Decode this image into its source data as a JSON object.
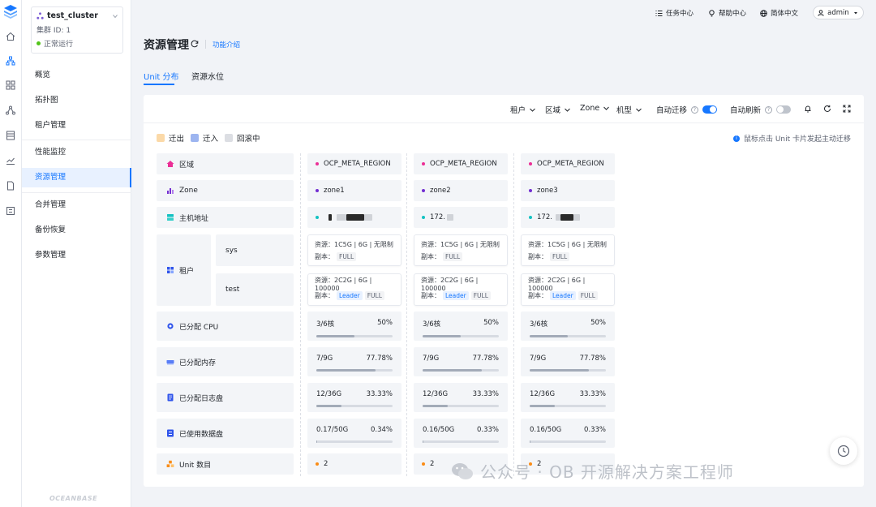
{
  "sidebar": {
    "cluster": {
      "name": "test_cluster",
      "id_text": "集群 ID: 1",
      "status": "正常运行"
    },
    "items": [
      {
        "label": "概览"
      },
      {
        "label": "拓扑图"
      },
      {
        "label": "租户管理"
      },
      {
        "label": "性能监控"
      },
      {
        "label": "资源管理"
      },
      {
        "label": "合并管理"
      },
      {
        "label": "备份恢复"
      },
      {
        "label": "参数管理"
      }
    ],
    "active_item": "资源管理",
    "footer_brand": "OCEANBASE"
  },
  "topbar": {
    "links": [
      {
        "label": "任务中心",
        "icon": "list-icon"
      },
      {
        "label": "帮助中心",
        "icon": "bulb-icon"
      },
      {
        "label": "简体中文",
        "icon": "globe-icon"
      }
    ],
    "user": "admin"
  },
  "header": {
    "title": "资源管理",
    "feature_link": "功能介绍"
  },
  "tabs": [
    {
      "label": "Unit 分布"
    },
    {
      "label": "资源水位"
    }
  ],
  "filters": {
    "region": "区域",
    "zone": "Zone",
    "machine": "机型",
    "tenant": "租户",
    "auto_migrate_label": "自动迁移",
    "auto_migrate_on": true,
    "auto_refresh_label": "自动刷新",
    "auto_refresh_on": false
  },
  "legend": [
    {
      "label": "迁出",
      "color": "#fbd9a8"
    },
    {
      "label": "迁入",
      "color": "#9db5f0"
    },
    {
      "label": "回滚中",
      "color": "#dcdee3"
    }
  ],
  "hint": "鼠标点击 Unit 卡片发起主动迁移",
  "rows": {
    "region": "区域",
    "zone": "Zone",
    "host": "主机地址",
    "tenant": "租户",
    "tenant_sys": "sys",
    "tenant_test": "test",
    "cpu": "已分配 CPU",
    "memory": "已分配内存",
    "log_disk": "已分配日志盘",
    "data_disk": "已使用数据盘",
    "unit_count": "Unit 数目"
  },
  "units": [
    {
      "region": "OCP_META_REGION",
      "zone": "zone1",
      "host": "",
      "sys": {
        "resource": "资源：1C5G | 6G | 无限制",
        "replica_label": "副本：",
        "replica": "FULL"
      },
      "test": {
        "resource": "资源：2C2G | 6G | 100000",
        "replica_label": "副本：",
        "leader": "Leader",
        "replica": "FULL"
      },
      "cpu": {
        "text": "3/6核",
        "pct": "50%",
        "value": 0.5
      },
      "memory": {
        "text": "7/9G",
        "pct": "77.78%",
        "value": 0.7778
      },
      "log_disk": {
        "text": "12/36G",
        "pct": "33.33%",
        "value": 0.3333
      },
      "data_disk": {
        "text": "0.17/50G",
        "pct": "0.34%",
        "value": 0.0034
      },
      "unit_count": "2"
    },
    {
      "region": "OCP_META_REGION",
      "zone": "zone2",
      "host": "172.",
      "sys": {
        "resource": "资源：1C5G | 6G | 无限制",
        "replica_label": "副本：",
        "replica": "FULL"
      },
      "test": {
        "resource": "资源：2C2G | 6G | 100000",
        "replica_label": "副本：",
        "leader": "Leader",
        "replica": "FULL"
      },
      "cpu": {
        "text": "3/6核",
        "pct": "50%",
        "value": 0.5
      },
      "memory": {
        "text": "7/9G",
        "pct": "77.78%",
        "value": 0.7778
      },
      "log_disk": {
        "text": "12/36G",
        "pct": "33.33%",
        "value": 0.3333
      },
      "data_disk": {
        "text": "0.16/50G",
        "pct": "0.33%",
        "value": 0.0033
      },
      "unit_count": "2"
    },
    {
      "region": "OCP_META_REGION",
      "zone": "zone3",
      "host": "172.",
      "sys": {
        "resource": "资源：1C5G | 6G | 无限制",
        "replica_label": "副本：",
        "replica": "FULL"
      },
      "test": {
        "resource": "资源：2C2G | 6G | 100000",
        "replica_label": "副本：",
        "leader": "Leader",
        "replica": "FULL"
      },
      "cpu": {
        "text": "3/6核",
        "pct": "50%",
        "value": 0.5
      },
      "memory": {
        "text": "7/9G",
        "pct": "77.78%",
        "value": 0.7778
      },
      "log_disk": {
        "text": "12/36G",
        "pct": "33.33%",
        "value": 0.3333
      },
      "data_disk": {
        "text": "0.16/50G",
        "pct": "0.33%",
        "value": 0.0033
      },
      "unit_count": "2"
    }
  ],
  "colors": {
    "accent": "#1677ff",
    "region_dot": "#eb2f96",
    "zone_dot": "#722ed1",
    "host_dot": "#13c2c2",
    "unit_dot": "#fa8c16"
  },
  "watermark": "公众号 · OB 开源解决方案工程师"
}
